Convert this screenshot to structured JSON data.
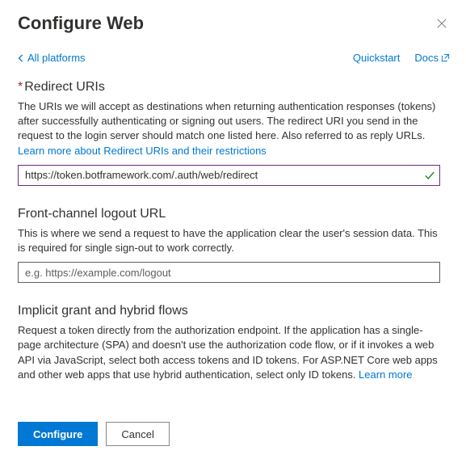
{
  "header": {
    "title": "Configure Web"
  },
  "topnav": {
    "back_label": "All platforms",
    "quickstart_label": "Quickstart",
    "docs_label": "Docs"
  },
  "sections": {
    "redirect": {
      "heading": "Redirect URIs",
      "required": true,
      "desc": "The URIs we will accept as destinations when returning authentication responses (tokens) after successfully authenticating or signing out users. The redirect URI you send in the request to the login server should match one listed here. Also referred to as reply URLs.",
      "learn_more": "Learn more about Redirect URIs and their restrictions",
      "input_value": "https://token.botframework.com/.auth/web/redirect"
    },
    "logout": {
      "heading": "Front-channel logout URL",
      "desc": "This is where we send a request to have the application clear the user's session data. This is required for single sign-out to work correctly.",
      "placeholder": "e.g. https://example.com/logout"
    },
    "implicit": {
      "heading": "Implicit grant and hybrid flows",
      "desc": "Request a token directly from the authorization endpoint. If the application has a single-page architecture (SPA) and doesn't use the authorization code flow, or if it invokes a web API via JavaScript, select both access tokens and ID tokens. For ASP.NET Core web apps and other web apps that use hybrid authentication, select only ID tokens. ",
      "learn_more": "Learn more"
    }
  },
  "footer": {
    "configure_label": "Configure",
    "cancel_label": "Cancel"
  }
}
